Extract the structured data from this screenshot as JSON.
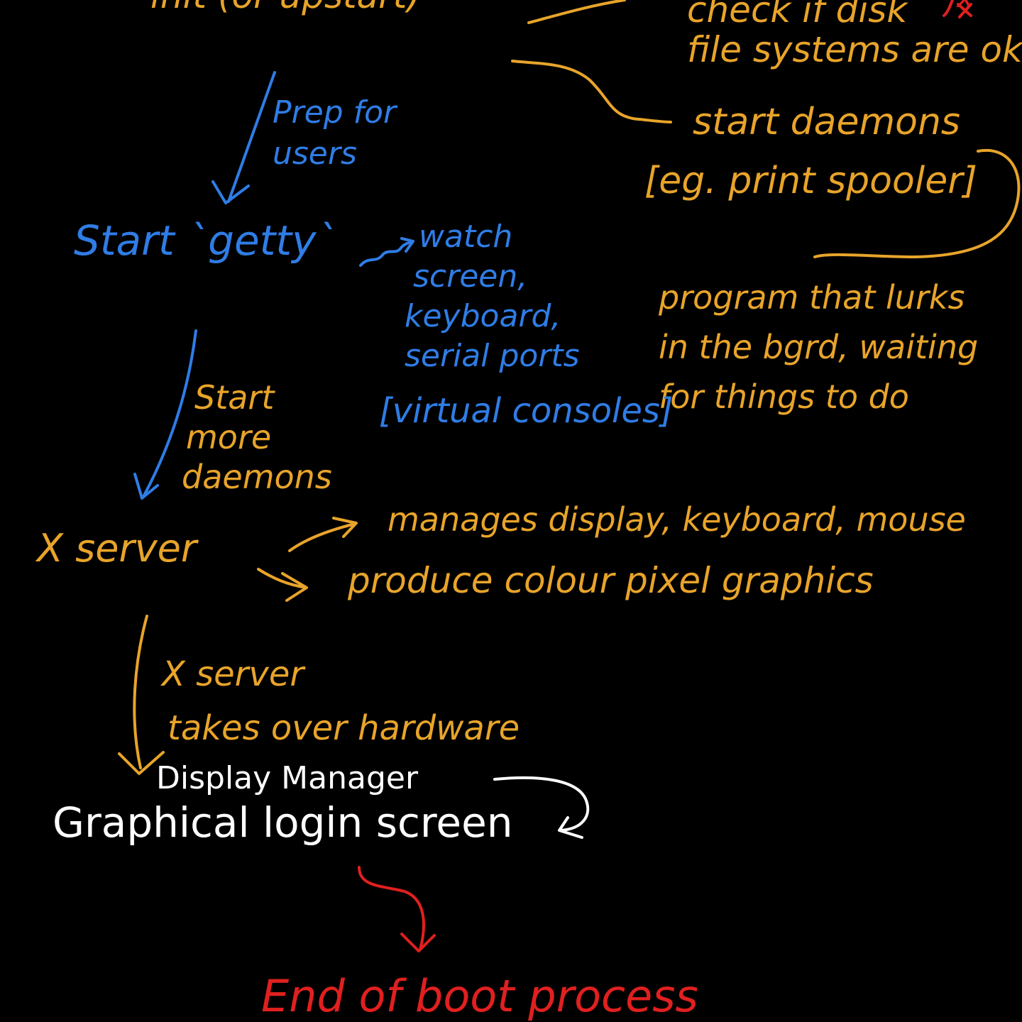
{
  "colors": {
    "background": "#000000",
    "orange": "#e8a42a",
    "blue": "#2f7de6",
    "white": "#ffffff",
    "red": "#e0201f"
  },
  "top": {
    "init_partial": "init (or upstart)",
    "red_mark": "x"
  },
  "init_tasks": {
    "check_disks": [
      "check if disk",
      "file systems are ok"
    ],
    "start_daemons": [
      "start daemons",
      "[eg. print spooler]"
    ]
  },
  "daemon_definition": [
    "program that lurks",
    "in the bgrd, waiting",
    "for things to do"
  ],
  "prep_label": [
    "Prep for",
    "users"
  ],
  "getty": {
    "label": "Start `getty`",
    "desc": [
      "watch",
      "screen,",
      "keyboard,",
      "serial ports"
    ],
    "virtual_consoles": "[virtual consoles]"
  },
  "more_daemons_label": [
    "Start",
    "more",
    "daemons"
  ],
  "x_server": {
    "label": "X server",
    "manages": "manages display, keyboard, mouse",
    "produces": "produce colour pixel graphics"
  },
  "takeover_label": [
    "X server",
    "takes over hardware"
  ],
  "display_manager": {
    "label": "Display Manager",
    "login": "Graphical login screen"
  },
  "end": "End of boot process"
}
